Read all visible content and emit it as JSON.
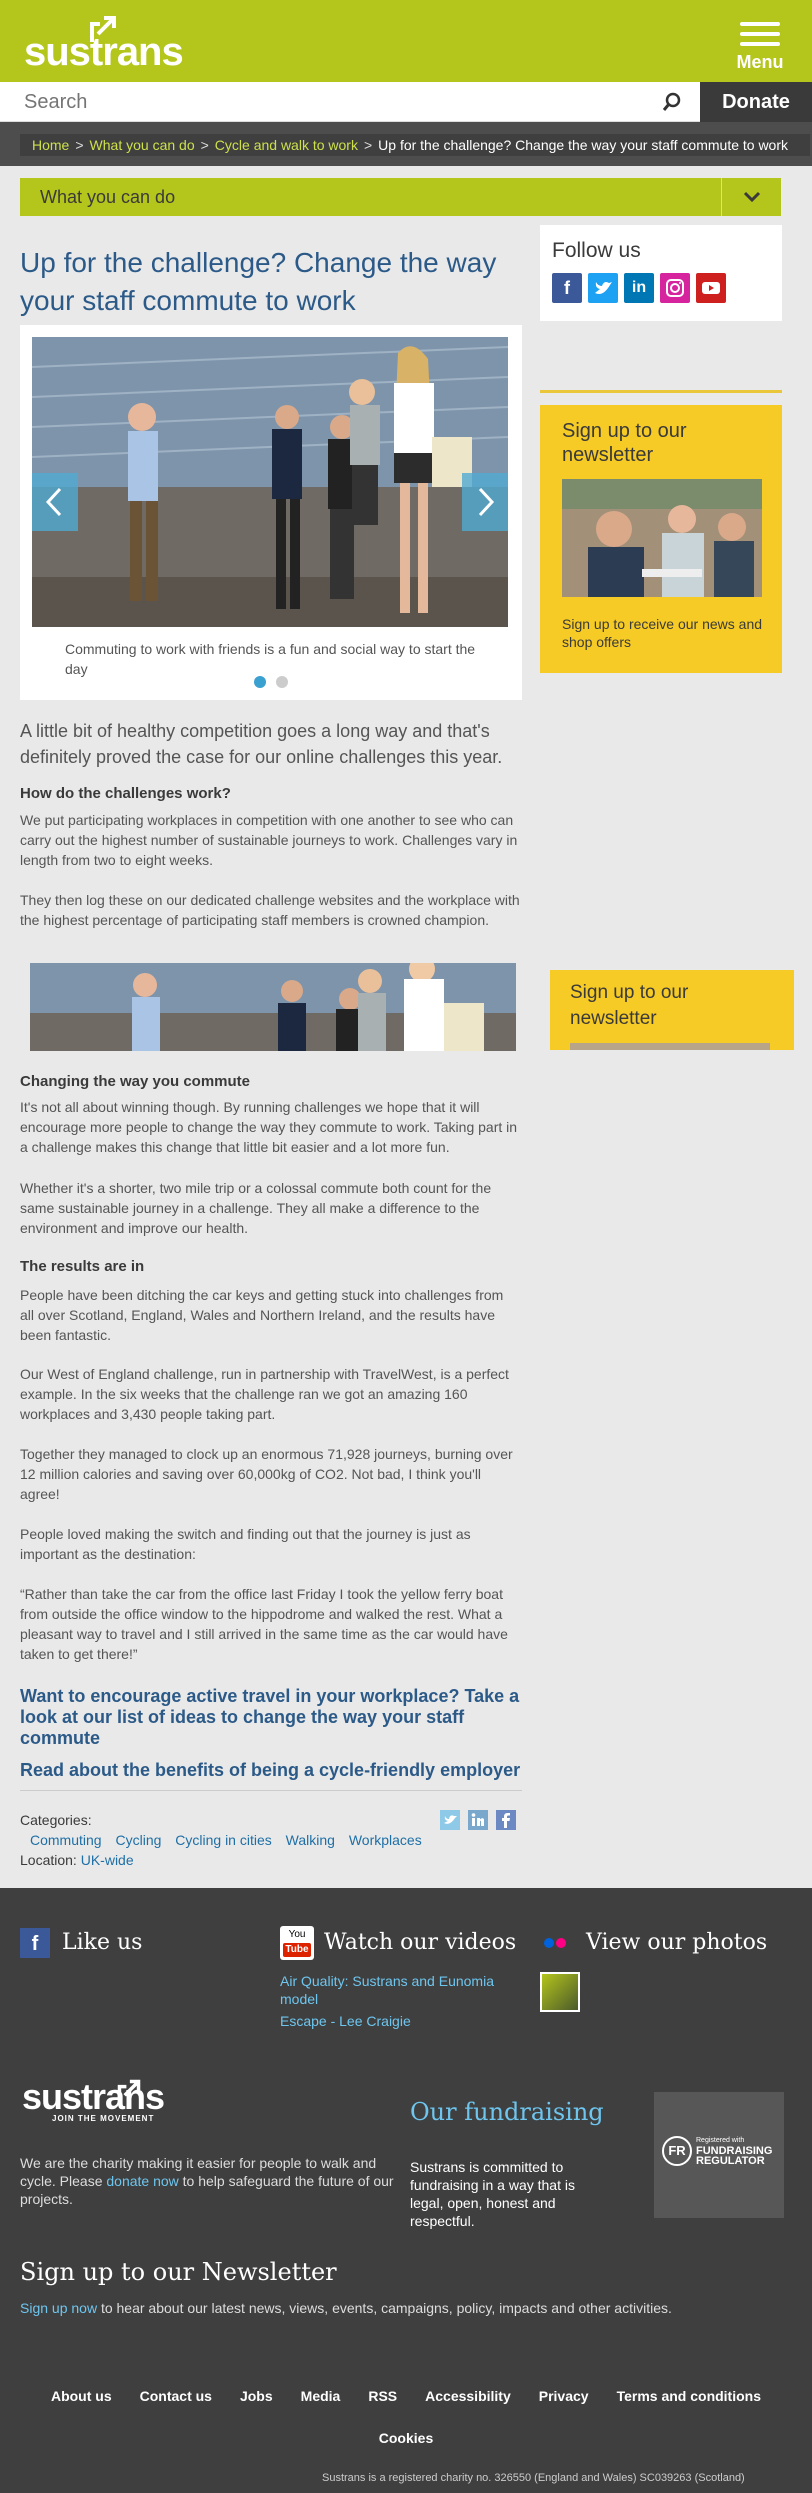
{
  "header": {
    "logo": "sustrans",
    "menu_label": "Menu",
    "search_placeholder": "Search",
    "donate_label": "Donate"
  },
  "breadcrumb": {
    "items": [
      "Home",
      "What you can do",
      "Cycle and walk to work"
    ],
    "current": "Up for the challenge? Change the way your staff commute to work"
  },
  "section_dropdown": {
    "label": "What you can do"
  },
  "article": {
    "title": "Up for the challenge? Change the way your staff commute to work",
    "slider_caption": "Commuting to work with friends is a fun and social way to start the day",
    "intro": "A little bit of healthy competition goes a long way and that's definitely proved the case for our online challenges this year.",
    "h_how": "How do the challenges work?",
    "p_how1": "We put participating workplaces in competition with one another to see who can carry out the highest number of sustainable journeys to work. Challenges vary in length from two to eight weeks.",
    "p_how2": "They then log these on our dedicated challenge websites and the workplace with the highest percentage of participating staff members is crowned champion.",
    "h_change": "Changing the way you commute",
    "p_change1": "It's not all about winning though. By running challenges we hope that it will encourage more people to change the way they commute to work. Taking part in a challenge makes this change that little bit easier and a lot more fun.",
    "p_change2": "Whether it's a shorter, two mile trip or a colossal commute both count for the same sustainable journey in a challenge. They all make a difference to the environment and improve our health.",
    "h_results": "The results are in",
    "p_results1": "People have been ditching the car keys and getting stuck into challenges from all over Scotland, England, Wales and Northern Ireland, and the results have been fantastic.",
    "p_results2": "Our West of England challenge, run in partnership with TravelWest, is a perfect example. In the six weeks that the challenge ran we got an amazing 160 workplaces and 3,430 people taking part.",
    "p_results3": "Together they managed to clock up an enormous 71,928 journeys, burning over 12 million calories and saving over 60,000kg of CO2. Not bad, I think you'll agree!",
    "p_results4": "People loved making the switch and finding out that the journey is just as important as the destination:",
    "quote": "“Rather than take the car from the office last Friday I took the yellow ferry boat from outside the office window to the hippodrome and walked the rest. What a pleasant way to travel and I still arrived in the same time as the car would have taken to get there!”",
    "cta1": "Want to encourage active travel in your workplace? Take a look at our list of ideas to change the way your staff commute",
    "cta2": "Read about the benefits of being a cycle-friendly employer",
    "categories_label": "Categories:",
    "categories": [
      "Commuting",
      "Cycling",
      "Cycling in cities",
      "Walking",
      "Workplaces"
    ],
    "location_label": "Location:",
    "location": "UK-wide"
  },
  "sidebar": {
    "follow_title": "Follow us",
    "newsletter_title": "Sign up to our newsletter",
    "newsletter_text": "Sign up to receive our news and shop offers",
    "newsletter2_title": "Sign up to our newsletter"
  },
  "footer": {
    "like_us": "Like us",
    "watch_videos": "Watch our videos",
    "videos": [
      "Air Quality: Sustrans and Eunomia model",
      "Escape - Lee Craigie"
    ],
    "view_photos": "View our photos",
    "logo": "sustrans",
    "logo_tagline": "JOIN THE MOVEMENT",
    "charity_text_1": "We are the charity making it easier for people to walk and cycle. Please",
    "donate_link": "donate now",
    "charity_text_2": "to help safeguard the future of our projects.",
    "fundraising_title": "Our fundraising",
    "fundraising_text": "Sustrans is committed to fundraising in a way that is legal, open, honest and respectful.",
    "fr_badge_small": "Registered with",
    "fr_badge_big": "FUNDRAISING REGULATOR",
    "newsletter_title": "Sign up to our Newsletter",
    "newsletter_link": "Sign up now",
    "newsletter_text": "to hear about our latest news, views, events, campaigns, policy, impacts and other activities.",
    "links": [
      "About us",
      "Contact us",
      "Jobs",
      "Media",
      "RSS",
      "Accessibility",
      "Privacy",
      "Terms and conditions"
    ],
    "cookies": "Cookies",
    "charity_no": "Sustrans is a registered charity no. 326550 (England and Wales) SC039263 (Scotland)"
  },
  "colors": {
    "brand_green": "#b4c51c",
    "heading_blue": "#2c5a88",
    "newsletter_yellow": "#f6cb25",
    "footer_bg": "#3f3f3f"
  }
}
